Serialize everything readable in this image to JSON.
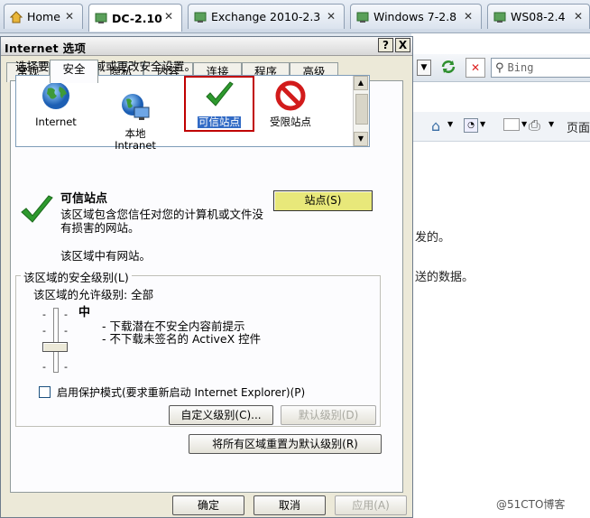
{
  "vm_tabs": [
    {
      "label": "Home",
      "active": false
    },
    {
      "label": "DC-2.10",
      "active": true
    },
    {
      "label": "Exchange 2010-2.3",
      "active": false
    },
    {
      "label": "Windows 7-2.8",
      "active": false
    },
    {
      "label": "WS08-2.4",
      "active": false
    }
  ],
  "background_ie": {
    "search_placeholder": "Bing",
    "page_menu": "页面",
    "text_line1": "发的。",
    "text_line2": "送的数据。"
  },
  "dialog": {
    "title": "Internet 选项",
    "help_btn": "?",
    "close_btn": "X",
    "tabs": [
      "常规",
      "安全",
      "隐私",
      "内容",
      "连接",
      "程序",
      "高级"
    ],
    "zone_prompt": "选择要查看的区域或更改安全设置。",
    "zones": [
      {
        "label": "Internet"
      },
      {
        "label": "本地\nIntranet"
      },
      {
        "label": "可信站点"
      },
      {
        "label": "受限站点"
      }
    ],
    "selected_zone_name": "可信站点",
    "sites_button": "站点(S)",
    "zone_description": "该区域包含您信任对您的计算机或文件没有损害的网站。",
    "zone_sites_note": "该区域中有网站。",
    "security_group_label": "该区域的安全级别(L)",
    "allowed_levels": "该区域的允许级别: 全部",
    "level_name": "中",
    "level_bullets": [
      "- 下载潜在不安全内容前提示",
      "- 不下载未签名的 ActiveX 控件"
    ],
    "protected_mode_label": "启用保护模式(要求重新启动 Internet Explorer)(P)",
    "protected_mode_checked": false,
    "custom_level_button": "自定义级别(C)...",
    "default_level_button": "默认级别(D)",
    "reset_all_button": "将所有区域重置为默认级别(R)",
    "ok_button": "确定",
    "cancel_button": "取消",
    "apply_button": "应用(A)"
  },
  "watermark": "@51CTO博客",
  "colors": {
    "sites_button_bg": "#e8e87a",
    "highlight_border": "#c00000",
    "check_green": "#2e9a2e"
  }
}
